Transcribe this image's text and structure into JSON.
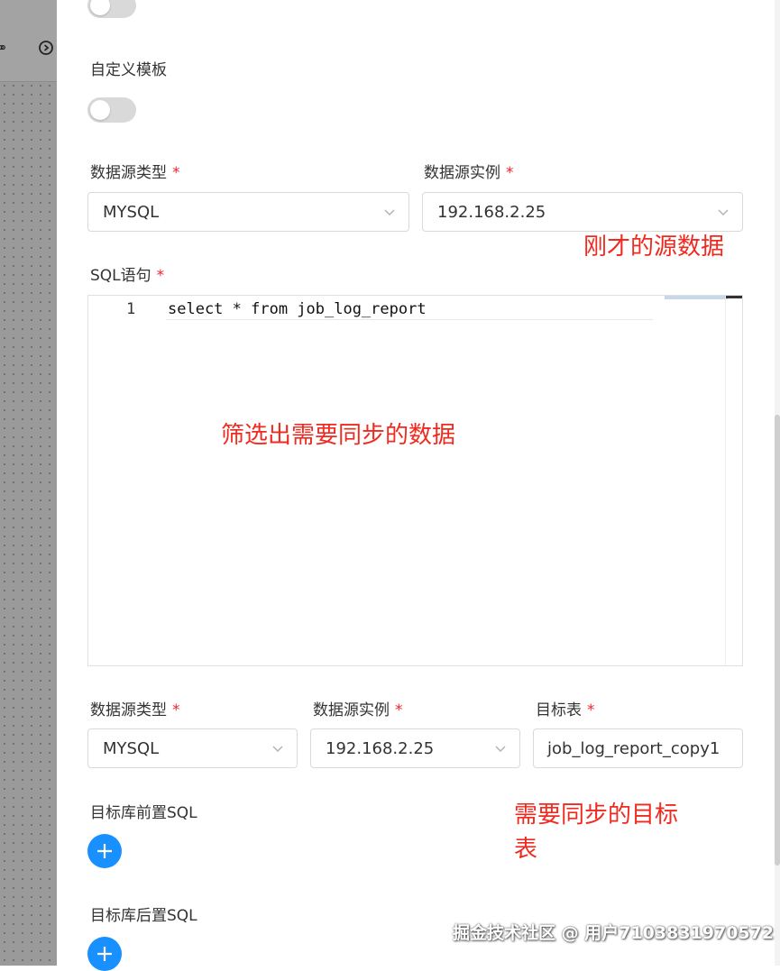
{
  "custom_template": {
    "label": "自定义模板"
  },
  "source": {
    "type_label": "数据源类型",
    "type_value": "MYSQL",
    "instance_label": "数据源实例",
    "instance_value": "192.168.2.25"
  },
  "sql": {
    "label": "SQL语句",
    "line_number": "1",
    "code": "select * from job_log_report"
  },
  "target": {
    "type_label": "数据源类型",
    "type_value": "MYSQL",
    "instance_label": "数据源实例",
    "instance_value": "192.168.2.25",
    "table_label": "目标表",
    "table_value": "job_log_report_copy1",
    "pre_sql_label": "目标库前置SQL",
    "post_sql_label": "目标库后置SQL"
  },
  "required_mark": "*",
  "annotations": {
    "source_note": "刚才的源数据",
    "sql_note": "筛选出需要同步的数据",
    "target_note_line1": "需要同步的目标",
    "target_note_line2": "表"
  },
  "watermark": "掘金技术社区 @ 用户7103831970572",
  "colors": {
    "required": "#f5222d",
    "annotation": "#f02a1f",
    "add_button": "#1890ff",
    "toggle_off": "#d9d9d9"
  }
}
